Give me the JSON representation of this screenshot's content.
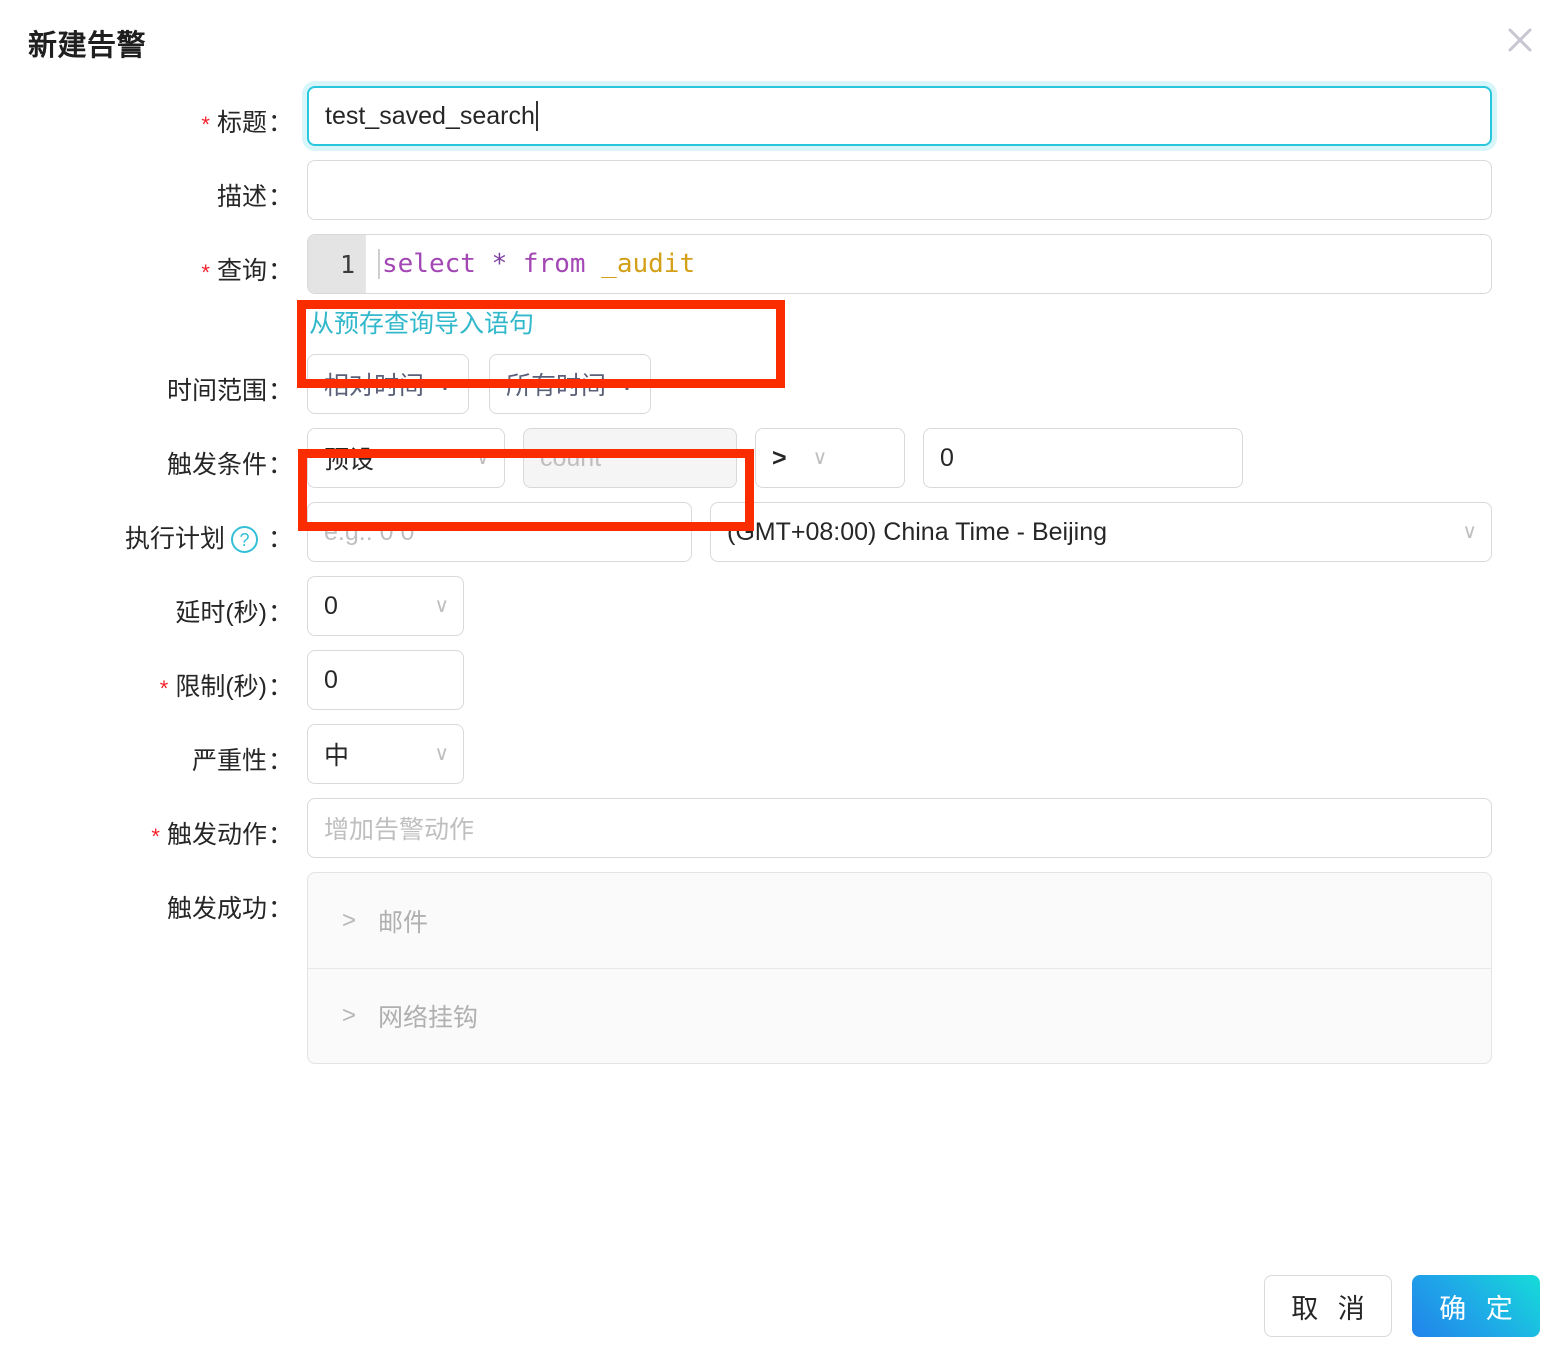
{
  "dialog": {
    "title": "新建告警",
    "close_icon": "close-icon"
  },
  "form": {
    "title_field": {
      "label": "标题",
      "required": true,
      "value": "test_saved_search"
    },
    "description_field": {
      "label": "描述",
      "required": false,
      "value": ""
    },
    "query_field": {
      "label": "查询",
      "required": true,
      "line_number": "1",
      "tokens": {
        "select": "select",
        "star": "*",
        "from": "from",
        "table": "_audit"
      },
      "full_text": "select * from _audit",
      "import_link": "从预存查询导入语句"
    },
    "time_range": {
      "label": "时间范围",
      "mode_value": "相对时间",
      "range_value": "所有时间"
    },
    "trigger_condition": {
      "label": "触发条件",
      "preset_value": "预设",
      "metric_placeholder": "count",
      "operator_value": ">",
      "threshold_value": "0"
    },
    "schedule": {
      "label": "执行计划",
      "help_icon": "question-circle-icon",
      "cron_placeholder": "e.g.: 0 0 * * *",
      "timezone_value": "(GMT+08:00) China Time - Beijing"
    },
    "delay": {
      "label": "延时(秒)",
      "value": "0"
    },
    "limit": {
      "label": "限制(秒)",
      "required": true,
      "value": "0"
    },
    "severity": {
      "label": "严重性",
      "value": "中"
    },
    "trigger_action": {
      "label": "触发动作",
      "required": true,
      "placeholder": "增加告警动作"
    },
    "trigger_success": {
      "label": "触发成功",
      "items": [
        {
          "label": "邮件",
          "icon": "chevron-right-icon"
        },
        {
          "label": "网络挂钩",
          "icon": "chevron-right-icon"
        }
      ]
    }
  },
  "footer": {
    "cancel_label": "取 消",
    "confirm_label": "确 定"
  },
  "colors": {
    "accent_cyan": "#29c7dd",
    "link": "#32b8cb",
    "required_star": "#f5222d",
    "annotation_red": "#fb2c00",
    "keyword_purple": "#a347b5",
    "table_gold": "#d4a017",
    "confirm_gradient_start": "#2083ea",
    "confirm_gradient_end": "#16dcd8"
  }
}
